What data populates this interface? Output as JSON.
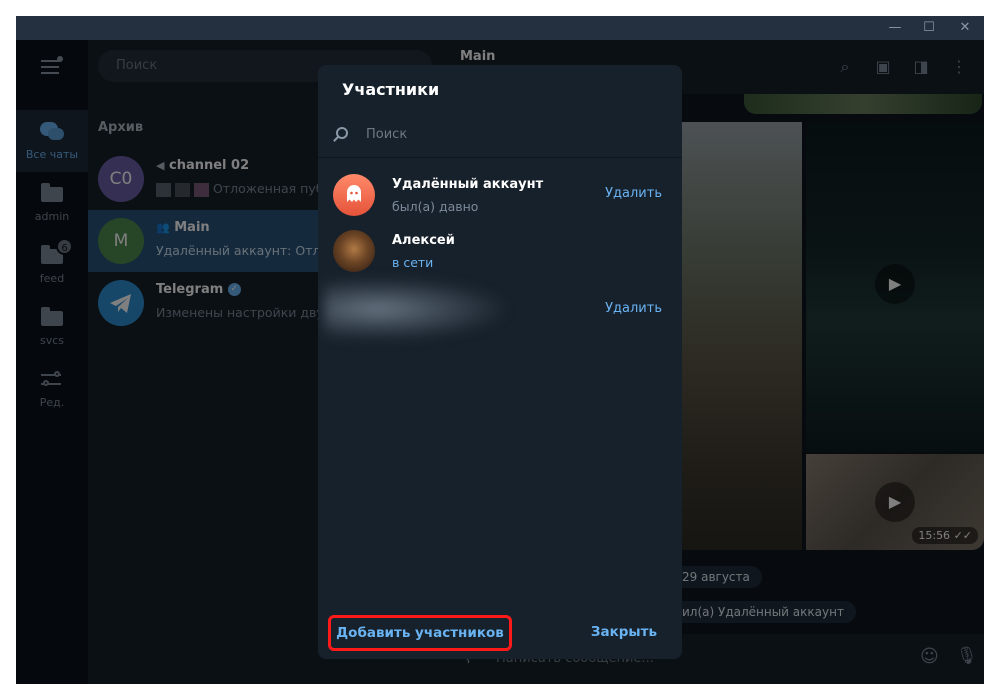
{
  "sidebar": {
    "items": [
      {
        "label": "Все чаты",
        "icon": "chat-bubbles-icon"
      },
      {
        "label": "admin",
        "icon": "folder-icon"
      },
      {
        "label": "feed",
        "icon": "folder-icon",
        "badge": "6"
      },
      {
        "label": "svcs",
        "icon": "folder-icon"
      },
      {
        "label": "Ред.",
        "icon": "sliders-icon"
      }
    ]
  },
  "chatlist": {
    "search_placeholder": "Поиск",
    "archive_label": "Архив",
    "chats": [
      {
        "avatar": "C0",
        "title": "channel 02",
        "preview": "Отложенная пуб",
        "avatar_color": "#6c5fa8"
      },
      {
        "avatar": "M",
        "title": "Main",
        "preview": "Удалённый аккаунт: Отлож",
        "avatar_color": "#4e8a4e"
      },
      {
        "avatar": "",
        "title": "Telegram",
        "preview": "Изменены настройки двух",
        "avatar_color": "#2f8fd1"
      }
    ]
  },
  "chat": {
    "title": "Main",
    "date_pill": "29 августа",
    "service_message": "ил(а) Удалённый аккаунт",
    "video_time": "15:56",
    "composer_placeholder": "Написать сообщение..."
  },
  "modal": {
    "title": "Участники",
    "search_placeholder": "Поиск",
    "members": [
      {
        "name": "Удалённый аккаунт",
        "status": "был(а) давно",
        "action": "Удалить",
        "online": false
      },
      {
        "name": "Алексей",
        "status": "в сети",
        "action": "",
        "online": true
      },
      {
        "name": "",
        "status": "",
        "action": "Удалить",
        "online": false
      }
    ],
    "add_button": "Добавить участников",
    "close_button": "Закрыть"
  },
  "colors": {
    "accent": "#6ab3f3",
    "highlight_border": "#ff1a1a",
    "selected_chat": "#2b5278"
  }
}
